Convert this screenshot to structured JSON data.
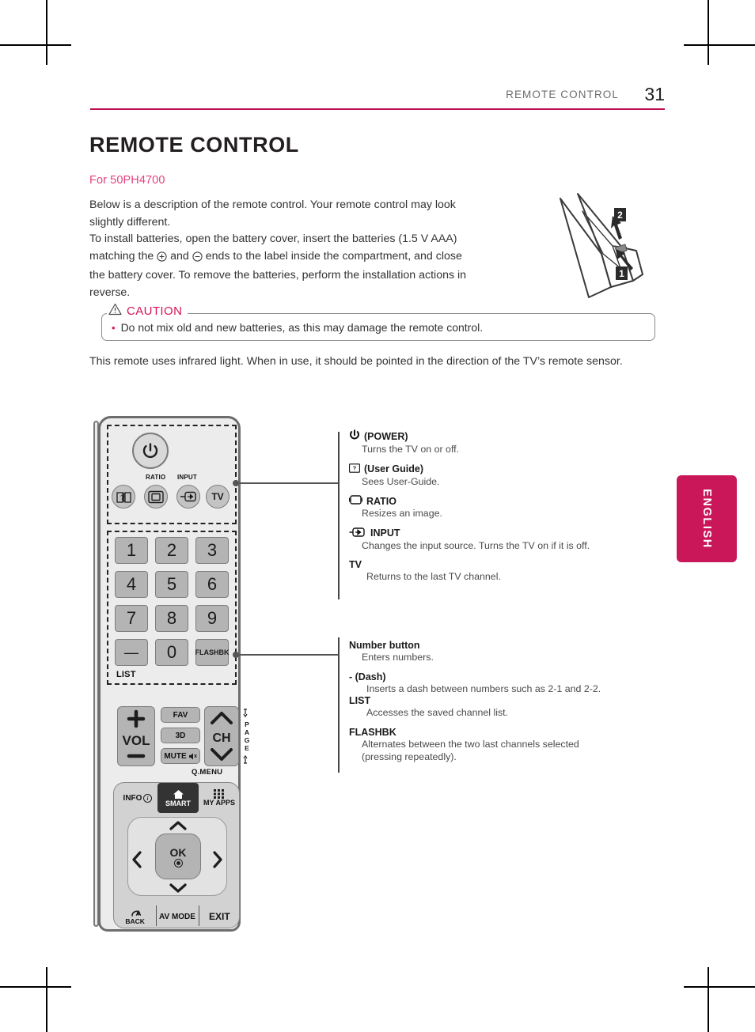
{
  "header": {
    "section_title": "REMOTE CONTROL",
    "page_number": "31"
  },
  "language_tab": {
    "label": "ENGLISH",
    "color": "#c9175a"
  },
  "content": {
    "h1": "REMOTE CONTROL",
    "model_line": "For 50PH4700",
    "intro_line1": "Below is a description of the remote control. Your remote control may look",
    "intro_line2": "slightly different.",
    "intro_line3": "To install batteries, open the battery cover, insert the batteries (1.5 V AAA)",
    "intro_line4a": "matching the",
    "intro_line4b": "and",
    "intro_line4c": "ends to the label inside the compartment, and close",
    "intro_line5": "the battery cover. To remove the batteries, perform the installation actions in",
    "intro_line6": "reverse.",
    "infrared_note": "This remote uses infrared light. When in use, it should be pointed in the direction of the TV’s remote sensor."
  },
  "caution": {
    "title": "CAUTION",
    "bullet": "•",
    "text": "Do not mix old and new batteries, as this may damage the remote control.",
    "title_color": "#d4145a"
  },
  "battery_diagram": {
    "step1": "1",
    "step2": "2"
  },
  "remote": {
    "labels": {
      "ratio": "RATIO",
      "input": "INPUT",
      "tv": "TV",
      "list": "LIST",
      "flashbk": "FLASHBK",
      "vol": "VOL",
      "ch": "CH",
      "page": "PAGE",
      "fav": "FAV",
      "three_d": "3D",
      "mute": "MUTE",
      "qmenu": "Q.MENU",
      "info": "INFO",
      "smart": "SMART",
      "myapps": "MY APPS",
      "ok": "OK",
      "back": "BACK",
      "avmode": "AV MODE",
      "exit": "EXIT"
    },
    "number_keys": [
      "1",
      "2",
      "3",
      "4",
      "5",
      "6",
      "7",
      "8",
      "9",
      "0"
    ],
    "dash_key": "—"
  },
  "annotations": {
    "group1": [
      {
        "icon": "power-icon",
        "title": "(POWER)",
        "desc": "Turns the TV on or off."
      },
      {
        "icon": "user-guide-icon",
        "title": "(User Guide)",
        "desc": "Sees User-Guide."
      },
      {
        "icon": "ratio-icon",
        "title": "RATIO",
        "desc": "Resizes an image."
      },
      {
        "icon": "input-icon",
        "title": "INPUT",
        "desc": "Changes the input source. Turns the TV on if it is off."
      },
      {
        "icon": "",
        "title": "TV",
        "desc": "Returns to the last TV channel."
      }
    ],
    "group2": [
      {
        "title": "Number button",
        "desc": "Enters numbers."
      },
      {
        "title": "- (Dash)",
        "desc": "Inserts a dash between numbers such as 2-1 and 2-2."
      },
      {
        "title": "LIST",
        "desc": "Accesses the saved channel list."
      },
      {
        "title": "FLASHBK",
        "desc_line1": "Alternates between the two last channels selected",
        "desc_line2": "(pressing repeatedly)."
      }
    ]
  }
}
